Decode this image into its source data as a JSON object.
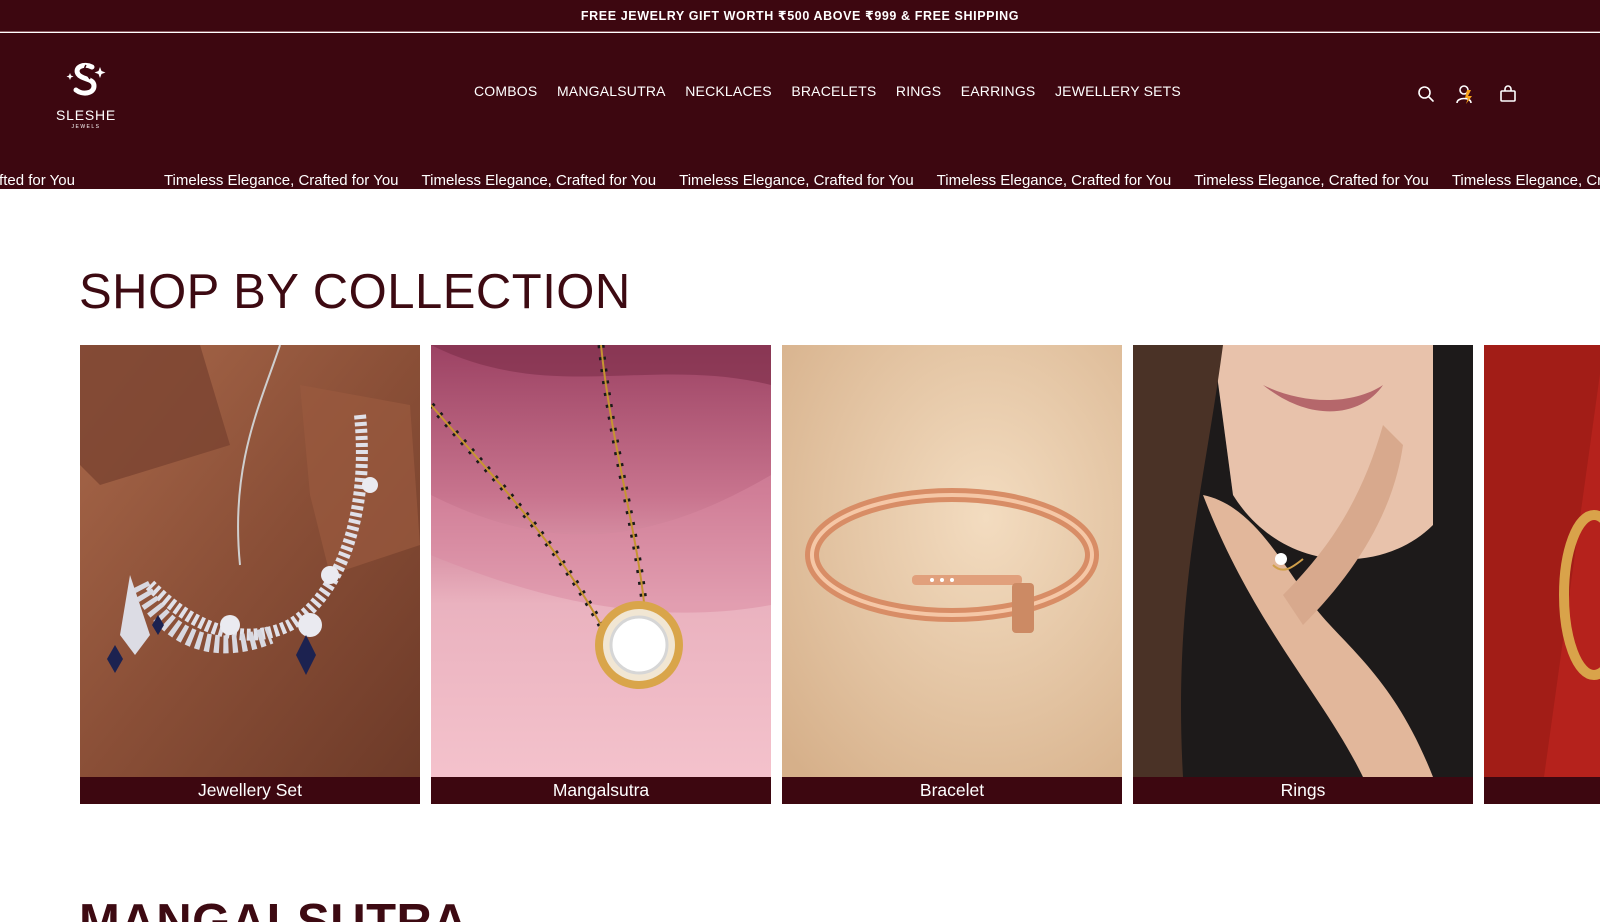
{
  "announcement": {
    "text": "FREE JEWELRY GIFT WORTH ₹500 ABOVE ₹999 & FREE SHIPPING"
  },
  "brand": {
    "name": "SLESHE",
    "tagline": "JEWELS"
  },
  "nav": {
    "items": [
      "COMBOS",
      "MANGALSUTRA",
      "NECKLACES",
      "BRACELETS",
      "RINGS",
      "EARRINGS",
      "JEWELLERY SETS"
    ]
  },
  "header_icons": [
    "search-icon",
    "account-icon",
    "cart-icon"
  ],
  "marquee": {
    "first_partial": "ance, Crafted for You",
    "items": [
      "Timeless Elegance, Crafted for You",
      "Timeless Elegance, Crafted for You",
      "Timeless Elegance, Crafted for You",
      "Timeless Elegance, Crafted for You",
      "Timeless Elegance, Crafted for You",
      "Timeless Elegance, Crafted for You"
    ]
  },
  "collection": {
    "title": "SHOP BY COLLECTION",
    "cards": [
      {
        "label": "Jewellery Set"
      },
      {
        "label": "Mangalsutra"
      },
      {
        "label": "Bracelet"
      },
      {
        "label": "Rings"
      },
      {
        "label": ""
      }
    ]
  },
  "next_section": {
    "title": "MANGALSUTRA"
  },
  "colors": {
    "brand": "#3d0710",
    "text": "#3d0a12",
    "white": "#ffffff"
  }
}
